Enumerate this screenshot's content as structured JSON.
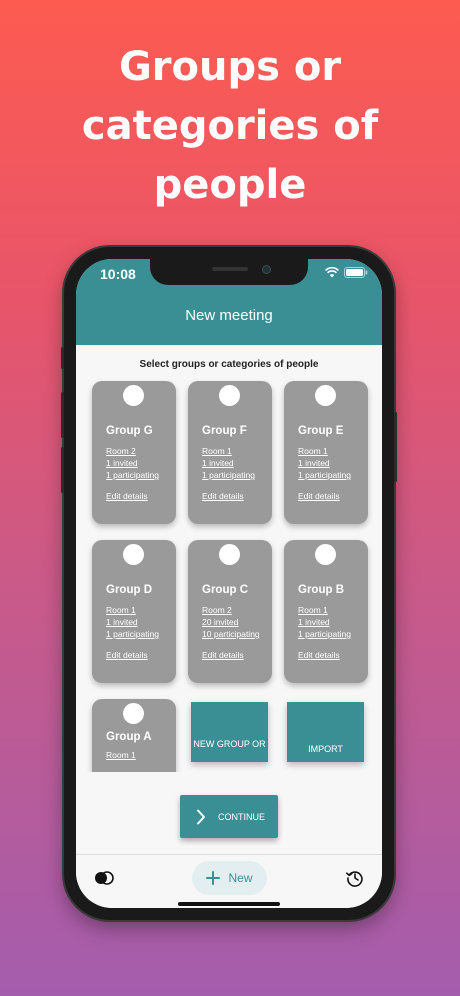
{
  "headline": [
    "Groups or",
    "categories of",
    "people"
  ],
  "status": {
    "time": "10:08"
  },
  "appbar": {
    "title": "New meeting"
  },
  "subtitle": "Select groups or categories of people",
  "groups": [
    {
      "name": "Group G",
      "room": "Room 2",
      "invited": "1 invited",
      "participating": "1 participating",
      "edit": "Edit details"
    },
    {
      "name": "Group F",
      "room": "Room 1",
      "invited": "1 invited",
      "participating": "1 participating",
      "edit": "Edit details"
    },
    {
      "name": "Group E",
      "room": "Room 1",
      "invited": "1 invited",
      "participating": "1 participating",
      "edit": "Edit details"
    },
    {
      "name": "Group D",
      "room": "Room 1",
      "invited": "1 invited",
      "participating": "1 participating",
      "edit": "Edit details"
    },
    {
      "name": "Group C",
      "room": "Room 2",
      "invited": "20 invited",
      "participating": "10 participating",
      "edit": "Edit details"
    },
    {
      "name": "Group B",
      "room": "Room 1",
      "invited": "1 invited",
      "participating": "1 participating",
      "edit": "Edit details"
    },
    {
      "name": "Group A",
      "room": "Room 1"
    }
  ],
  "tiles": {
    "new_group": "NEW GROUP OR",
    "import": "IMPORT"
  },
  "continue_label": "CONTINUE",
  "bottom": {
    "new_label": "New"
  },
  "colors": {
    "accent": "#3a8f94",
    "card": "#9a9a9a",
    "gradient_top": "#fd5b50",
    "gradient_bottom": "#a45dad"
  }
}
